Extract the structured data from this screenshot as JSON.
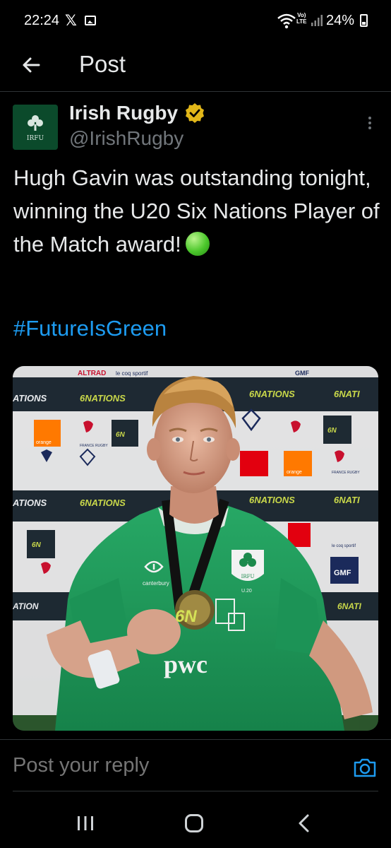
{
  "status_bar": {
    "time": "22:24",
    "x_icon": "x-logo-icon",
    "volte_line1": "Vo)",
    "volte_line2": "LTE",
    "battery": "24%"
  },
  "header": {
    "title": "Post",
    "back_icon": "back-arrow-icon"
  },
  "post": {
    "author_name": "Irish Rugby",
    "author_handle": "@IrishRugby",
    "avatar_text": "IRFU",
    "text": "Hugh Gavin was outstanding tonight, winning the U20 Six Nations Player of the Match award!",
    "emoji_icon": "green-circle-icon",
    "hashtag": "#FutureIsGreen",
    "media": {
      "sponsor_row_1": [
        "ALTRAD",
        "le coq sportif",
        "FRANCE RUGBY",
        "GMF"
      ],
      "banner_text": "6NATIONS",
      "board_logos": [
        "orange",
        "FRANCE RUGBY",
        "6N",
        "le coq sportif",
        "GMF"
      ],
      "jersey_brand": "canterbury",
      "jersey_sponsor": "pwc",
      "jersey_crest": "IRFU",
      "jersey_label": "U.20",
      "medal_text": "6N"
    }
  },
  "reply": {
    "placeholder": "Post your reply",
    "camera_icon": "camera-icon"
  },
  "nav": {
    "recents_icon": "recents-icon",
    "home_icon": "home-icon",
    "back_icon": "chevron-left-icon"
  },
  "colors": {
    "background": "#000000",
    "text": "#e7e9ea",
    "secondary_text": "#71767b",
    "link": "#1d9bf0",
    "verified": "#e2b719",
    "jersey_green": "#1f9a58"
  }
}
